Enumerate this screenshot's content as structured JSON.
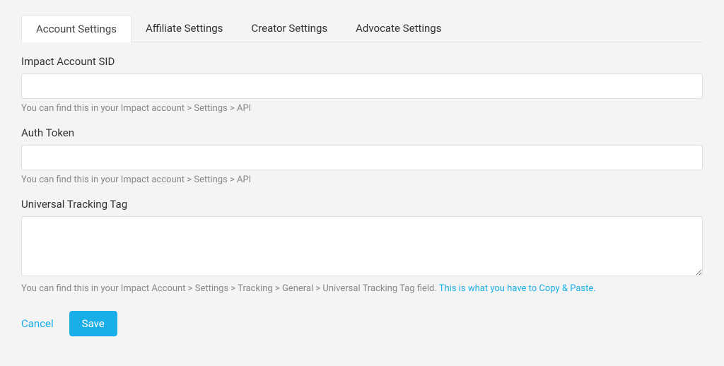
{
  "tabs": [
    {
      "label": "Account Settings",
      "active": true
    },
    {
      "label": "Affiliate Settings",
      "active": false
    },
    {
      "label": "Creator Settings",
      "active": false
    },
    {
      "label": "Advocate Settings",
      "active": false
    }
  ],
  "fields": {
    "sid": {
      "label": "Impact Account SID",
      "value": "",
      "help": "You can find this in your Impact account > Settings > API"
    },
    "auth_token": {
      "label": "Auth Token",
      "value": "",
      "help": "You can find this in your Impact account > Settings > API"
    },
    "tracking_tag": {
      "label": "Universal Tracking Tag",
      "value": "",
      "help": "You can find this in your Impact Account > Settings > Tracking > General > Universal Tracking Tag field. ",
      "help_link": "This is what you have to Copy & Paste."
    }
  },
  "actions": {
    "cancel": "Cancel",
    "save": "Save"
  }
}
